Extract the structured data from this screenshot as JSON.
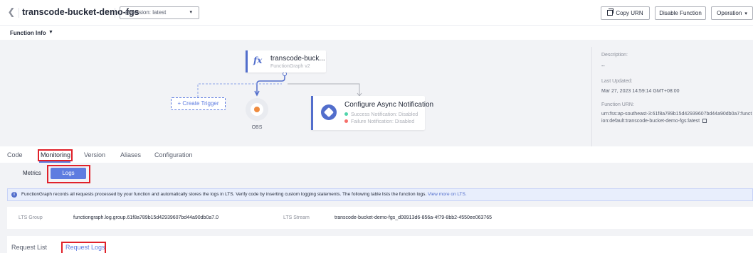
{
  "header": {
    "function_name": "transcode-bucket-demo-fgs",
    "version_value": "@Version: latest",
    "copy_urn_label": "Copy URN",
    "disable_label": "Disable Function",
    "operation_label": "Operation"
  },
  "function_info": {
    "label": "Function Info"
  },
  "diagram": {
    "function_node_name": "transcode-buck...",
    "function_node_subtitle": "FunctionGraph v2",
    "create_trigger_label": "+ Create Trigger",
    "trigger_label": "OBS",
    "async_title": "Configure Async Notification",
    "async_success": "Success Notification: Disabled",
    "async_failure": "Failure Notification: Disabled",
    "colors": {
      "success": "#50d4ab",
      "failure": "#f66f6a",
      "accent": "#526ecc"
    }
  },
  "info": {
    "description_label": "Description:",
    "description_value": "--",
    "updated_label": "Last Updated:",
    "updated_value": "Mar 27, 2023 14:59:14 GMT+08:00",
    "urn_label": "Function URN:",
    "urn_value": "urn:fss:ap-southeast-3:61f8a789b15d42939607bd44a90db0a7:function:default:transcode-bucket-demo-fgs:latest"
  },
  "tabs": {
    "code": "Code",
    "monitoring": "Monitoring",
    "version": "Version",
    "aliases": "Aliases",
    "configuration": "Configuration"
  },
  "subtabs": {
    "metrics": "Metrics",
    "logs": "Logs"
  },
  "banner": {
    "text": "FunctionGraph records all requests processed by your function and automatically stores the logs in LTS. Verify code by inserting custom logging statements. The following table lists the function logs.",
    "link": "View more on LTS."
  },
  "lts": {
    "group_label": "LTS Group",
    "group_value": "functiongraph.log.group.61f8a789b15d42939607bd44a90db0a7.0",
    "stream_label": "LTS Stream",
    "stream_value": "transcode-bucket-demo-fgs_d08913d6-856a-4f79-8bb2-4550ee063765"
  },
  "request_tabs": {
    "list": "Request List",
    "logs": "Request Logs"
  }
}
